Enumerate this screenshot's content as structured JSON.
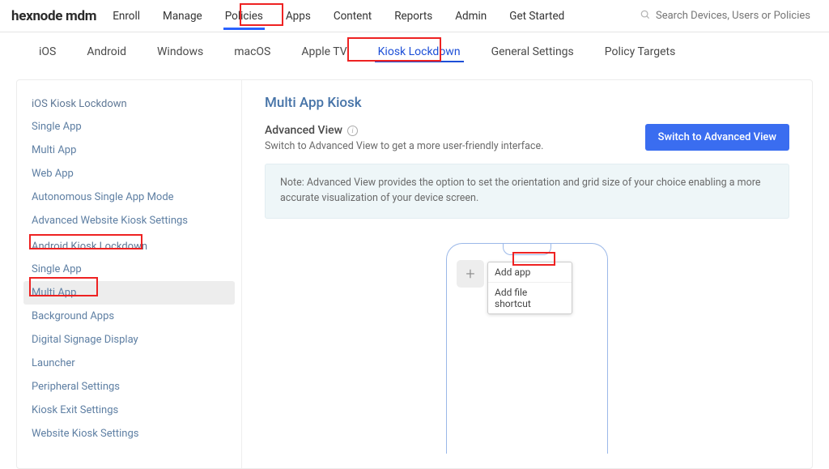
{
  "logo": "hexnode mdm",
  "topnav": {
    "enroll": "Enroll",
    "manage": "Manage",
    "policies": "Policies",
    "apps": "Apps",
    "content": "Content",
    "reports": "Reports",
    "admin": "Admin",
    "get_started": "Get Started"
  },
  "search": {
    "placeholder": "Search Devices, Users or Policies"
  },
  "subtabs": {
    "ios": "iOS",
    "android": "Android",
    "windows": "Windows",
    "macos": "macOS",
    "appletv": "Apple TV",
    "kiosk": "Kiosk Lockdown",
    "general": "General Settings",
    "targets": "Policy Targets"
  },
  "sidebar": {
    "ios_header": "iOS Kiosk Lockdown",
    "ios": {
      "single": "Single App",
      "multi": "Multi App",
      "web": "Web App",
      "asam": "Autonomous Single App Mode",
      "advweb": "Advanced Website Kiosk Settings"
    },
    "and_header": "Android Kiosk Lockdown",
    "and": {
      "single": "Single App",
      "multi": "Multi App",
      "bg": "Background Apps",
      "dsd": "Digital Signage Display",
      "launcher": "Launcher",
      "periph": "Peripheral Settings",
      "exit": "Kiosk Exit Settings",
      "webkiosk": "Website Kiosk Settings"
    }
  },
  "main": {
    "title": "Multi App Kiosk",
    "adv_title": "Advanced View",
    "adv_sub": "Switch to Advanced View to get a more user-friendly interface.",
    "switch_btn": "Switch to Advanced View",
    "note": "Note: Advanced View provides the option to set the orientation and grid size of your choice enabling a more accurate visualization of your device screen.",
    "popover": {
      "add_app": "Add app",
      "add_shortcut": "Add file shortcut"
    }
  }
}
